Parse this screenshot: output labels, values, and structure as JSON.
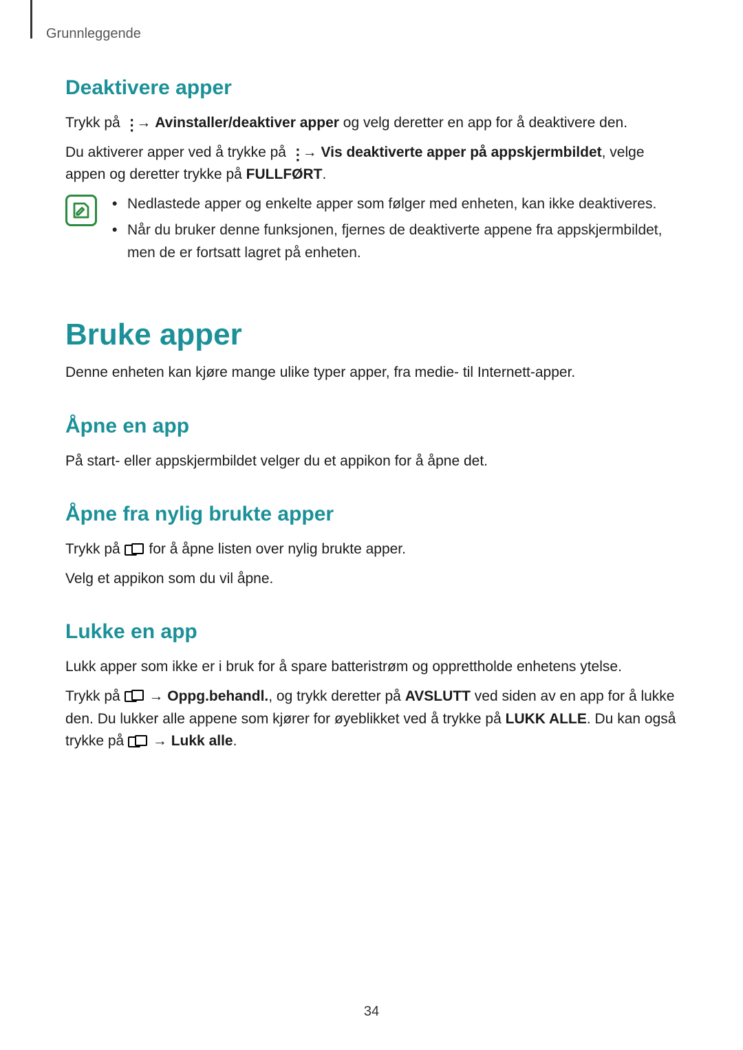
{
  "breadcrumb": "Grunnleggende",
  "page_number": "34",
  "s1": {
    "heading": "Deaktivere apper",
    "p1_a": "Trykk på ",
    "p1_b": " → ",
    "p1_bold1": "Avinstaller/deaktiver apper",
    "p1_c": " og velg deretter en app for å deaktivere den.",
    "p2_a": "Du aktiverer apper ved å trykke på ",
    "p2_b": " → ",
    "p2_bold1": "Vis deaktiverte apper på appskjermbildet",
    "p2_c": ", velge appen og deretter trykke på ",
    "p2_bold2": "FULLFØRT",
    "p2_d": ".",
    "note1": "Nedlastede apper og enkelte apper som følger med enheten, kan ikke deaktiveres.",
    "note2": "Når du bruker denne funksjonen, fjernes de deaktiverte appene fra appskjermbildet, men de er fortsatt lagret på enheten."
  },
  "s2": {
    "heading": "Bruke apper",
    "p1": "Denne enheten kan kjøre mange ulike typer apper, fra medie- til Internett-apper."
  },
  "s3": {
    "heading": "Åpne en app",
    "p1": "På start- eller appskjermbildet velger du et appikon for å åpne det."
  },
  "s4": {
    "heading": "Åpne fra nylig brukte apper",
    "p1_a": "Trykk på ",
    "p1_b": " for å åpne listen over nylig brukte apper.",
    "p2": "Velg et appikon som du vil åpne."
  },
  "s5": {
    "heading": "Lukke en app",
    "p1": "Lukk apper som ikke er i bruk for å spare batteristrøm og opprettholde enhetens ytelse.",
    "p2_a": "Trykk på ",
    "p2_b": " → ",
    "p2_bold1": "Oppg.behandl.",
    "p2_c": ", og trykk deretter på ",
    "p2_bold2": "AVSLUTT",
    "p2_d": " ved siden av en app for å lukke den. Du lukker alle appene som kjører for øyeblikket ved å trykke på ",
    "p2_bold3": "LUKK ALLE",
    "p2_e": ". Du kan også trykke på ",
    "p2_f": " → ",
    "p2_bold4": "Lukk alle",
    "p2_g": "."
  }
}
